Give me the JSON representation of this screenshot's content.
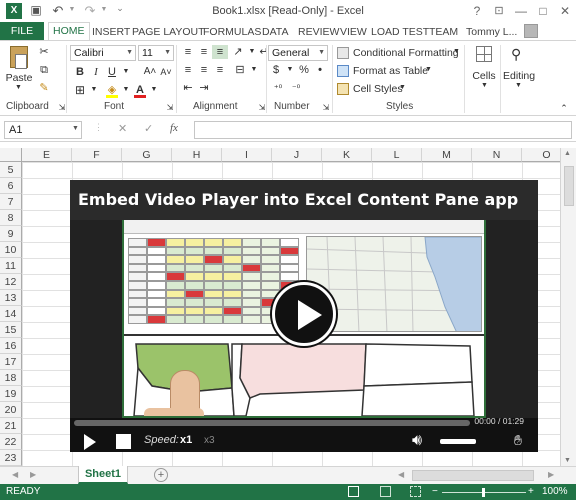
{
  "window": {
    "title": "Book1.xlsx  [Read-Only] - Excel",
    "help": "?",
    "minimize": "—",
    "restore": "□",
    "close": "✕"
  },
  "tabs": [
    "FILE",
    "HOME",
    "INSERT",
    "PAGE LAYOUT",
    "FORMULAS",
    "DATA",
    "REVIEW",
    "VIEW",
    "LOAD TEST",
    "TEAM"
  ],
  "user": "Tommy L...",
  "ribbon": {
    "clipboard": {
      "paste": "Paste",
      "label": "Clipboard"
    },
    "font": {
      "name": "Calibri",
      "size": "11",
      "bold": "B",
      "italic": "I",
      "underline": "U",
      "grow": "A˄",
      "shrink": "A˅",
      "label": "Font"
    },
    "alignment": {
      "label": "Alignment"
    },
    "number": {
      "format": "General",
      "currency": "$",
      "percent": "%",
      "comma": "•",
      "label": "Number"
    },
    "styles": {
      "conditional": "Conditional Formatting",
      "table": "Format as Table",
      "cell": "Cell Styles",
      "label": "Styles"
    },
    "cells": {
      "label": "Cells"
    },
    "editing": {
      "label": "Editing"
    }
  },
  "formula_bar": {
    "name_box": "A1",
    "cancel": "✕",
    "enter": "✓",
    "fx": "fx",
    "value": ""
  },
  "columns": [
    "E",
    "F",
    "G",
    "H",
    "I",
    "J",
    "K",
    "L",
    "M",
    "N",
    "O"
  ],
  "rows": [
    "5",
    "6",
    "7",
    "8",
    "9",
    "10",
    "11",
    "12",
    "13",
    "14",
    "15",
    "16",
    "17",
    "18",
    "19",
    "20",
    "21",
    "22",
    "23"
  ],
  "video": {
    "title": "Embed Video Player into Excel Content Pane app",
    "time": "00:00 / 01:29",
    "speed_label": "Speed:",
    "speed_active": "x1",
    "speed_alt": "x3"
  },
  "sheet": {
    "tab": "Sheet1",
    "add": "+"
  },
  "status": {
    "ready": "READY",
    "zoom": "100%",
    "zoom_out": "−",
    "zoom_in": "+"
  },
  "colors": {
    "excel_green": "#217346",
    "video_bg": "#222222",
    "cell_green": "#9bc36a",
    "cell_red": "#d9393b",
    "cell_yellow": "#f6f0a0",
    "map_pink": "#f7dede"
  }
}
